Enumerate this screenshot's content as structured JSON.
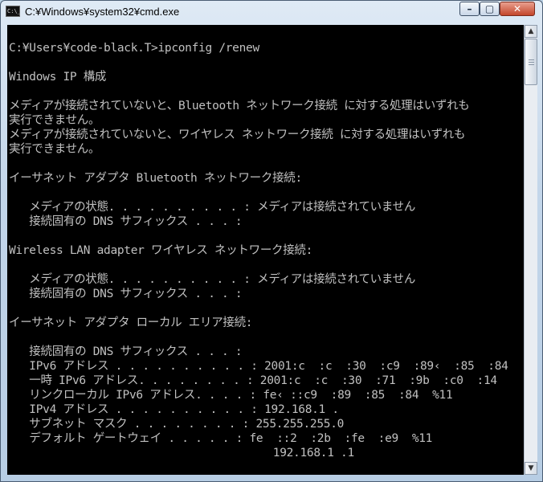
{
  "window": {
    "title": "C:¥Windows¥system32¥cmd.exe",
    "icon_label": "C:\\_",
    "controls": {
      "minimize": "–",
      "maximize": "▢",
      "close": "✕"
    }
  },
  "scrollbar": {
    "up": "▲",
    "down": "▼"
  },
  "console": {
    "lines": [
      "",
      "C:¥Users¥code-black.T>ipconfig /renew",
      "",
      "Windows IP 構成",
      "",
      "メディアが接続されていないと、Bluetooth ネットワーク接続 に対する処理はいずれも",
      "実行できません。",
      "メディアが接続されていないと、ワイヤレス ネットワーク接続 に対する処理はいずれも",
      "実行できません。",
      "",
      "イーサネット アダプタ Bluetooth ネットワーク接続:",
      "",
      "   メディアの状態. . . . . . . . . . : メディアは接続されていません",
      "   接続固有の DNS サフィックス . . . :",
      "",
      "Wireless LAN adapter ワイヤレス ネットワーク接続:",
      "",
      "   メディアの状態. . . . . . . . . . : メディアは接続されていません",
      "   接続固有の DNS サフィックス . . . :",
      "",
      "イーサネット アダプタ ローカル エリア接続:",
      "",
      "   接続固有の DNS サフィックス . . . :",
      "   IPv6 アドレス . . . . . . . . . . : 2001:c  :c  :30  :c9  :89‹  :85  :84",
      "   一時 IPv6 アドレス. . . . . . . . : 2001:c  :c  :30  :71  :9b  :c0  :14",
      "   リンクローカル IPv6 アドレス. . . . : fe‹ ::c9  :89  :85  :84  %11",
      "   IPv4 アドレス . . . . . . . . . . : 192.168.1 .",
      "   サブネット マスク . . . . . . . . : 255.255.255.0",
      "   デフォルト ゲートウェイ . . . . . : fe  ::2  :2b  :fe  :e9  %11",
      "                                       192.168.1 .1"
    ]
  }
}
